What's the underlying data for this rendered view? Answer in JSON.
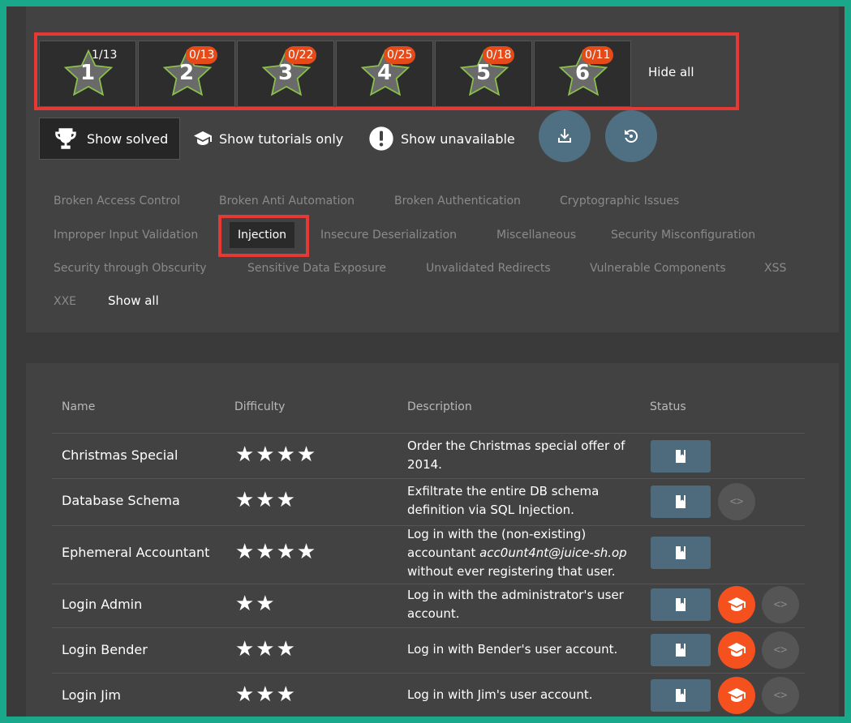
{
  "difficulty": [
    {
      "num": "1",
      "badge": "1/13",
      "badge_style": "plain"
    },
    {
      "num": "2",
      "badge": "0/13",
      "badge_style": "orange"
    },
    {
      "num": "3",
      "badge": "0/22",
      "badge_style": "orange"
    },
    {
      "num": "4",
      "badge": "0/25",
      "badge_style": "orange"
    },
    {
      "num": "5",
      "badge": "0/18",
      "badge_style": "orange"
    },
    {
      "num": "6",
      "badge": "0/11",
      "badge_style": "orange"
    }
  ],
  "hide_all": "Hide all",
  "toggles": {
    "show_solved": "Show solved",
    "show_tutorials": "Show tutorials only",
    "show_unavailable": "Show unavailable"
  },
  "categories": {
    "broken_access_control": "Broken Access Control",
    "broken_anti_automation": "Broken Anti Automation",
    "broken_authentication": "Broken Authentication",
    "cryptographic_issues": "Cryptographic Issues",
    "improper_input_validation": "Improper Input Validation",
    "injection": "Injection",
    "insecure_deserialization": "Insecure Deserialization",
    "miscellaneous": "Miscellaneous",
    "security_misconfiguration": "Security Misconfiguration",
    "security_through_obscurity": "Security through Obscurity",
    "sensitive_data_exposure": "Sensitive Data Exposure",
    "unvalidated_redirects": "Unvalidated Redirects",
    "vulnerable_components": "Vulnerable Components",
    "xss": "XSS",
    "xxe": "XXE",
    "show_all": "Show all"
  },
  "table": {
    "headers": {
      "name": "Name",
      "difficulty": "Difficulty",
      "description": "Description",
      "status": "Status"
    },
    "rows": [
      {
        "name": "Christmas Special",
        "stars": "★★★★",
        "desc": "Order the Christmas special offer of 2014."
      },
      {
        "name": "Database Schema",
        "stars": "★★★",
        "desc": "Exfiltrate the entire DB schema definition via SQL Injection."
      },
      {
        "name": "Ephemeral Accountant",
        "stars": "★★★★",
        "desc_pre": "Log in with the (non-existing) accountant ",
        "desc_em": "acc0unt4nt@juice-sh.op",
        "desc_post": " without ever registering that user."
      },
      {
        "name": "Login Admin",
        "stars": "★★",
        "desc": "Log in with the administrator's user account."
      },
      {
        "name": "Login Bender",
        "stars": "★★★",
        "desc": "Log in with Bender's user account."
      },
      {
        "name": "Login Jim",
        "stars": "★★★",
        "desc": "Log in with Jim's user account."
      }
    ]
  },
  "colors": {
    "accent": "#e64a19",
    "highlight": "#e53935",
    "button": "#4e6b7d",
    "frame": "#1aa88a"
  }
}
